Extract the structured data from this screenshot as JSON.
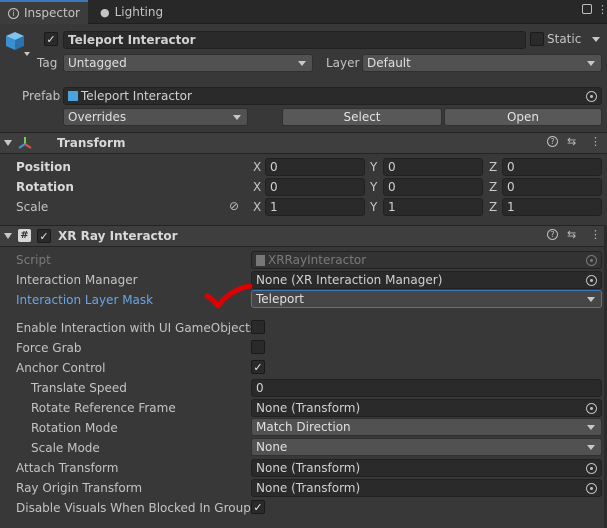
{
  "tabs": [
    {
      "label": "Inspector",
      "icon": "info-icon"
    },
    {
      "label": "Lighting",
      "icon": "lightbulb-icon"
    }
  ],
  "gameobject": {
    "name": "Teleport Interactor",
    "static_label": "Static",
    "tag_label": "Tag",
    "tag_value": "Untagged",
    "layer_label": "Layer",
    "layer_value": "Default",
    "prefab_label": "Prefab",
    "prefab_value": "Teleport Interactor",
    "overrides_label": "Overrides",
    "select_label": "Select",
    "open_label": "Open"
  },
  "transform": {
    "title": "Transform",
    "position_label": "Position",
    "rotation_label": "Rotation",
    "scale_label": "Scale",
    "axis_x": "X",
    "axis_y": "Y",
    "axis_z": "Z",
    "position": [
      "0",
      "0",
      "0"
    ],
    "rotation": [
      "0",
      "0",
      "0"
    ],
    "scale": [
      "1",
      "1",
      "1"
    ]
  },
  "xr": {
    "title": "XR Ray Interactor",
    "script_label": "Script",
    "script_value": "XRRayInteractor",
    "interaction_manager_label": "Interaction Manager",
    "interaction_manager_value": "None (XR Interaction Manager)",
    "layer_mask_label": "Interaction Layer Mask",
    "layer_mask_value": "Teleport",
    "enable_ui_label": "Enable Interaction with UI GameObjects",
    "force_grab_label": "Force Grab",
    "anchor_control_label": "Anchor Control",
    "translate_speed_label": "Translate Speed",
    "translate_speed_value": "0",
    "rotate_ref_label": "Rotate Reference Frame",
    "rotate_ref_value": "None (Transform)",
    "rotation_mode_label": "Rotation Mode",
    "rotation_mode_value": "Match Direction",
    "scale_mode_label": "Scale Mode",
    "scale_mode_value": "None",
    "attach_transform_label": "Attach Transform",
    "attach_transform_value": "None (Transform)",
    "ray_origin_label": "Ray Origin Transform",
    "ray_origin_value": "None (Transform)",
    "disable_visuals_label": "Disable Visuals When Blocked In Group"
  },
  "colors": {
    "accent": "#3a79bb",
    "link": "#6aa5e6",
    "annotation": "#e00000"
  }
}
